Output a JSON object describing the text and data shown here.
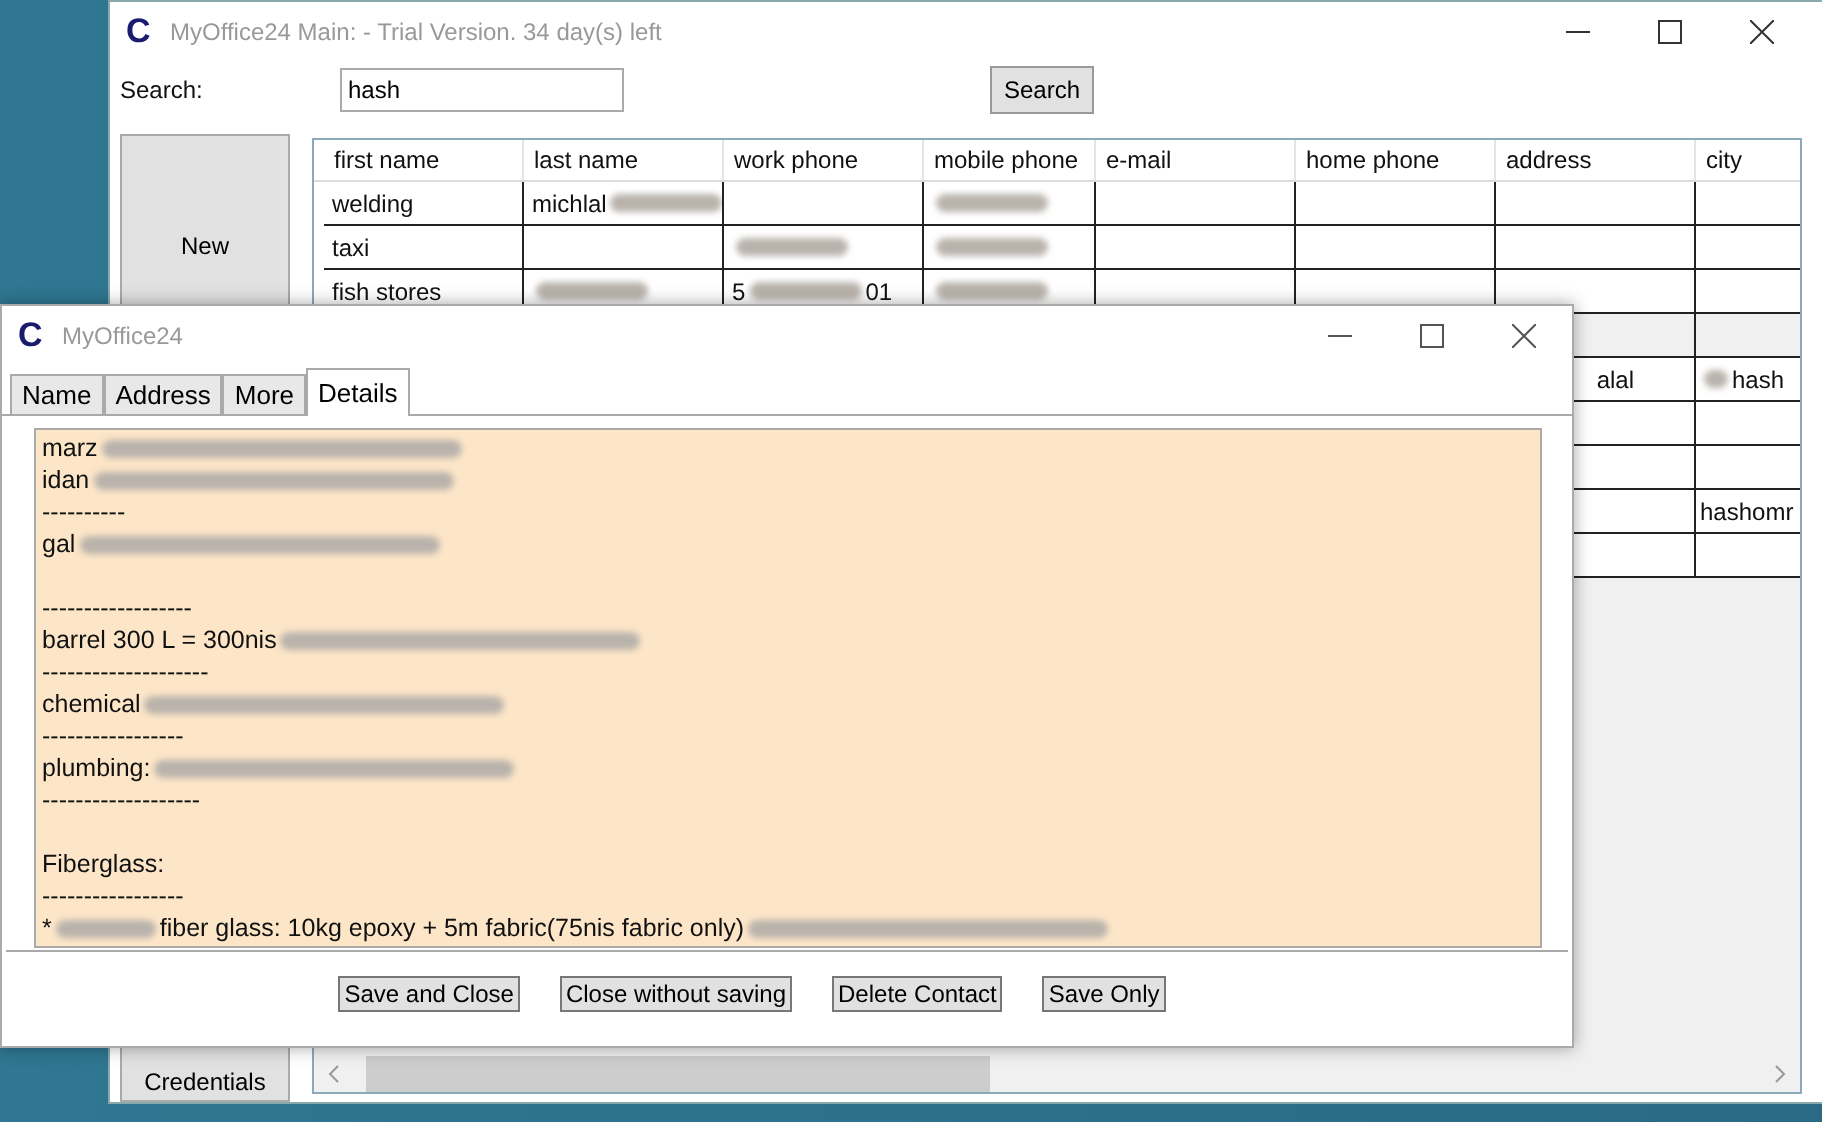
{
  "main_window": {
    "logo": "C",
    "title": "MyOffice24 Main: - Trial Version. 34 day(s) left",
    "search": {
      "label": "Search:",
      "value": "hash",
      "button": "Search"
    },
    "side_buttons": [
      "New",
      "Credentials"
    ],
    "table": {
      "columns": [
        "first name",
        "last name",
        "work phone",
        "mobile phone",
        "e-mail",
        "home phone",
        "address",
        "city"
      ],
      "rows": [
        {
          "selected": false,
          "cells": [
            {
              "kind": "text",
              "parts": [
                {
                  "kind": "text",
                  "text": "welding"
                }
              ]
            },
            {
              "kind": "text",
              "parts": [
                {
                  "kind": "text",
                  "text": "michlal"
                },
                {
                  "kind": "smear"
                }
              ]
            },
            {
              "kind": "blank"
            },
            {
              "kind": "text",
              "parts": [
                {
                  "kind": "smear"
                }
              ]
            },
            {
              "kind": "blank"
            },
            {
              "kind": "blank"
            },
            {
              "kind": "blank"
            },
            {
              "kind": "blank"
            }
          ]
        },
        {
          "selected": false,
          "cells": [
            {
              "kind": "text",
              "parts": [
                {
                  "kind": "text",
                  "text": "taxi"
                }
              ]
            },
            {
              "kind": "blank"
            },
            {
              "kind": "text",
              "parts": [
                {
                  "kind": "smear"
                }
              ]
            },
            {
              "kind": "text",
              "parts": [
                {
                  "kind": "smear"
                }
              ]
            },
            {
              "kind": "blank"
            },
            {
              "kind": "blank"
            },
            {
              "kind": "blank"
            },
            {
              "kind": "blank"
            }
          ]
        },
        {
          "selected": false,
          "cells": [
            {
              "kind": "text",
              "parts": [
                {
                  "kind": "text",
                  "text": "fish stores"
                }
              ]
            },
            {
              "kind": "text",
              "parts": [
                {
                  "kind": "smear"
                }
              ]
            },
            {
              "kind": "text",
              "parts": [
                {
                  "kind": "text",
                  "text": "5"
                },
                {
                  "kind": "smear"
                },
                {
                  "kind": "text",
                  "text": "01"
                }
              ]
            },
            {
              "kind": "text",
              "parts": [
                {
                  "kind": "smear"
                }
              ]
            },
            {
              "kind": "blank"
            },
            {
              "kind": "blank"
            },
            {
              "kind": "blank"
            },
            {
              "kind": "blank"
            }
          ]
        },
        {
          "selected": true,
          "cells": [
            {
              "kind": "blank"
            },
            {
              "kind": "blank"
            },
            {
              "kind": "blank"
            },
            {
              "kind": "blank"
            },
            {
              "kind": "blank"
            },
            {
              "kind": "blank"
            },
            {
              "kind": "blank"
            },
            {
              "kind": "blank"
            }
          ]
        },
        {
          "selected": false,
          "cells": [
            {
              "kind": "blank"
            },
            {
              "kind": "blank"
            },
            {
              "kind": "blank"
            },
            {
              "kind": "blank"
            },
            {
              "kind": "blank"
            },
            {
              "kind": "blank"
            },
            {
              "kind": "tail",
              "parts": [
                {
                  "kind": "text",
                  "text": "alal"
                }
              ]
            },
            {
              "kind": "text",
              "parts": [
                {
                  "kind": "smear"
                },
                {
                  "kind": "text",
                  "text": "hash"
                }
              ]
            }
          ]
        },
        {
          "selected": false,
          "cells": [
            {
              "kind": "blank"
            },
            {
              "kind": "blank"
            },
            {
              "kind": "blank"
            },
            {
              "kind": "blank"
            },
            {
              "kind": "blank"
            },
            {
              "kind": "blank"
            },
            {
              "kind": "blank"
            },
            {
              "kind": "blank"
            }
          ]
        },
        {
          "selected": false,
          "cells": [
            {
              "kind": "blank"
            },
            {
              "kind": "blank"
            },
            {
              "kind": "blank"
            },
            {
              "kind": "blank"
            },
            {
              "kind": "blank"
            },
            {
              "kind": "blank"
            },
            {
              "kind": "blank"
            },
            {
              "kind": "blank"
            }
          ]
        },
        {
          "selected": false,
          "cells": [
            {
              "kind": "blank"
            },
            {
              "kind": "blank"
            },
            {
              "kind": "blank"
            },
            {
              "kind": "blank"
            },
            {
              "kind": "blank"
            },
            {
              "kind": "blank"
            },
            {
              "kind": "blank"
            },
            {
              "kind": "text",
              "parts": [
                {
                  "kind": "text",
                  "text": "hashomr"
                }
              ]
            }
          ]
        },
        {
          "selected": false,
          "cells": [
            {
              "kind": "blank"
            },
            {
              "kind": "blank"
            },
            {
              "kind": "blank"
            },
            {
              "kind": "blank"
            },
            {
              "kind": "blank"
            },
            {
              "kind": "blank"
            },
            {
              "kind": "blank"
            },
            {
              "kind": "blank"
            }
          ]
        }
      ]
    }
  },
  "dialog": {
    "logo": "C",
    "title": "MyOffice24",
    "tabs": [
      {
        "label": "Name",
        "selected": false
      },
      {
        "label": "Address",
        "selected": false
      },
      {
        "label": "More",
        "selected": false
      },
      {
        "label": "Details",
        "selected": true
      }
    ],
    "details": [
      {
        "kind": "line",
        "parts": [
          {
            "kind": "text",
            "text": "marz"
          },
          {
            "kind": "smear"
          }
        ]
      },
      {
        "kind": "line",
        "parts": [
          {
            "kind": "text",
            "text": "idan"
          },
          {
            "kind": "smear"
          }
        ]
      },
      {
        "kind": "line",
        "parts": [
          {
            "kind": "text",
            "text": "----------"
          }
        ]
      },
      {
        "kind": "line",
        "parts": [
          {
            "kind": "text",
            "text": "gal"
          },
          {
            "kind": "smear"
          }
        ]
      },
      {
        "kind": "blank"
      },
      {
        "kind": "line",
        "parts": [
          {
            "kind": "text",
            "text": "------------------"
          }
        ]
      },
      {
        "kind": "line",
        "parts": [
          {
            "kind": "text",
            "text": "barrel 300 L = 300nis"
          },
          {
            "kind": "smear"
          }
        ]
      },
      {
        "kind": "line",
        "parts": [
          {
            "kind": "text",
            "text": "--------------------"
          }
        ]
      },
      {
        "kind": "line",
        "parts": [
          {
            "kind": "text",
            "text": "chemical"
          },
          {
            "kind": "smear"
          }
        ]
      },
      {
        "kind": "line",
        "parts": [
          {
            "kind": "text",
            "text": "-----------------"
          }
        ]
      },
      {
        "kind": "line",
        "parts": [
          {
            "kind": "text",
            "text": "plumbing:"
          },
          {
            "kind": "smear"
          }
        ]
      },
      {
        "kind": "line",
        "parts": [
          {
            "kind": "text",
            "text": "-------------------"
          }
        ]
      },
      {
        "kind": "blank"
      },
      {
        "kind": "line",
        "parts": [
          {
            "kind": "text",
            "text": "Fiberglass:"
          }
        ]
      },
      {
        "kind": "line",
        "parts": [
          {
            "kind": "text",
            "text": "-----------------"
          }
        ]
      },
      {
        "kind": "line",
        "parts": [
          {
            "kind": "text",
            "text": "*"
          },
          {
            "kind": "smear"
          },
          {
            "kind": "text",
            "text": "fiber glass: 10kg epoxy + 5m fabric(75nis fabric only)"
          },
          {
            "kind": "smear"
          }
        ]
      }
    ],
    "buttons": [
      "Save and Close",
      "Close without saving",
      "Delete Contact",
      "Save Only"
    ]
  }
}
